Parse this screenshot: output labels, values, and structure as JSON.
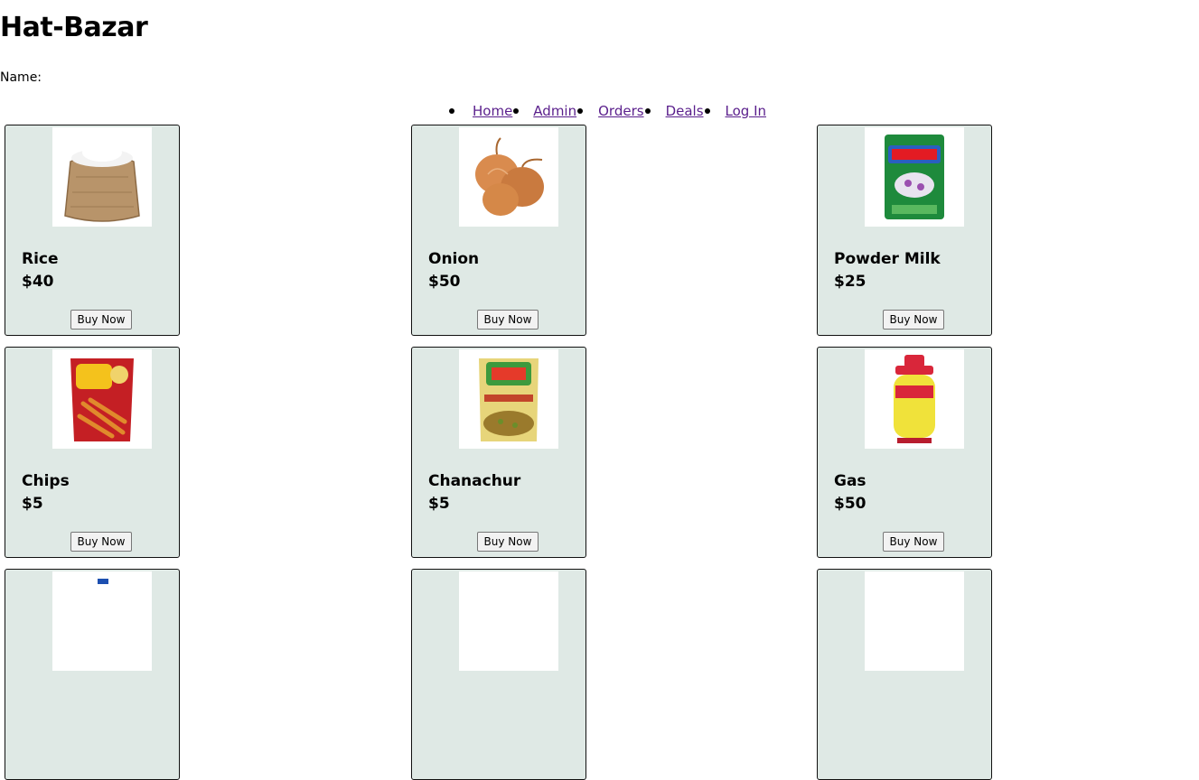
{
  "site": {
    "title": "Hat-Bazar",
    "name_label": "Name:"
  },
  "nav": {
    "items": [
      "Home",
      "Admin",
      "Orders",
      "Deals",
      "Log In"
    ]
  },
  "products": [
    {
      "name": "Rice",
      "price": "$40",
      "button": "Buy Now"
    },
    {
      "name": "Onion",
      "price": "$50",
      "button": "Buy Now"
    },
    {
      "name": "Powder Milk",
      "price": "$25",
      "button": "Buy Now"
    },
    {
      "name": "Chips",
      "price": "$5",
      "button": "Buy Now"
    },
    {
      "name": "Chanachur",
      "price": "$5",
      "button": "Buy Now"
    },
    {
      "name": "Gas",
      "price": "$50",
      "button": "Buy Now"
    }
  ],
  "colors": {
    "card_bg": "#dfe9e5",
    "link": "#5a1f8c"
  }
}
